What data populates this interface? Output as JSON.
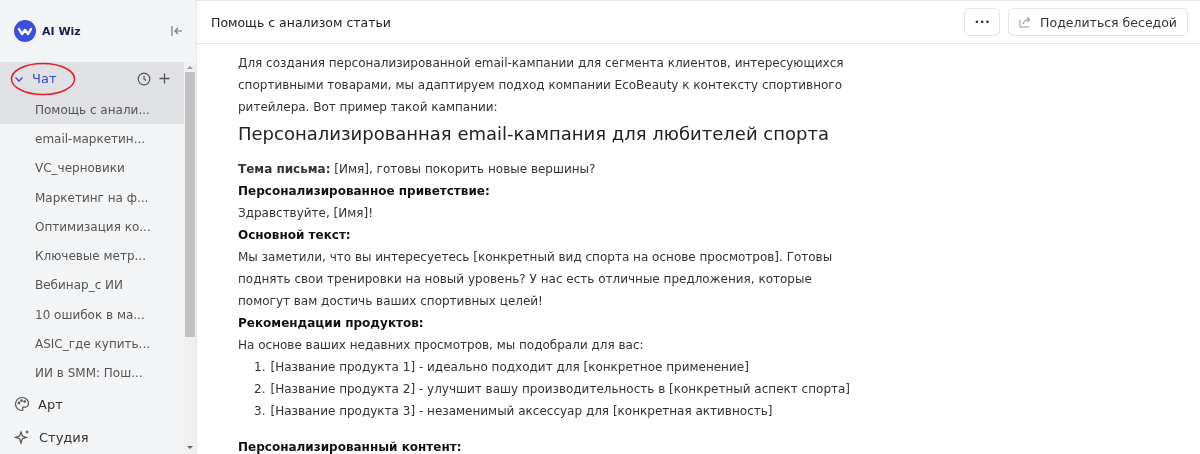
{
  "app": {
    "name": "AI Wiz"
  },
  "sidebar": {
    "sections": [
      {
        "label": "Чат",
        "kind": "chat",
        "expanded": true,
        "selected": true,
        "highlighted": true,
        "items": [
          {
            "label": "Помощь с анали...",
            "selected": true
          },
          {
            "label": "email-маркетин...",
            "selected": false
          },
          {
            "label": "VC_черновики",
            "selected": false
          },
          {
            "label": "Маркетинг на ф...",
            "selected": false
          },
          {
            "label": "Оптимизация ко...",
            "selected": false
          },
          {
            "label": "Ключевые метр...",
            "selected": false
          },
          {
            "label": "Вебинар_с ИИ",
            "selected": false
          },
          {
            "label": "10 ошибок в ма...",
            "selected": false
          },
          {
            "label": "ASIC_где купить...",
            "selected": false
          },
          {
            "label": "ИИ в SMM: Пош...",
            "selected": false
          }
        ]
      },
      {
        "label": "Арт",
        "kind": "art",
        "selected": false
      },
      {
        "label": "Студия",
        "kind": "studio",
        "selected": false
      }
    ]
  },
  "header": {
    "title": "Помощь с анализом статьи",
    "more_button": "•••",
    "share_button": "Поделиться беседой"
  },
  "message": [
    {
      "kind": "paragraph",
      "text": "Для создания персонализированной email-кампании для сегмента клиентов, интересующихся спортивными товарами, мы адаптируем подход компании EcoBeauty к контексту спортивного ритейлера. Вот пример такой кампании:"
    },
    {
      "kind": "heading",
      "text": "Персонализированная email-кампания для любителей спорта"
    },
    {
      "kind": "paragraph",
      "text": "**Тема письма:** [Имя], готовы покорить новые вершины?"
    },
    {
      "kind": "label",
      "text": "Персонализированное приветствие:"
    },
    {
      "kind": "paragraph",
      "text": "Здравствуйте, [Имя]!"
    },
    {
      "kind": "label",
      "text": "Основной текст:"
    },
    {
      "kind": "paragraph",
      "text": "Мы заметили, что вы интересуетесь [конкретный вид спорта на основе просмотров]. Готовы поднять свои тренировки на новый уровень? У нас есть отличные предложения, которые помогут вам достичь ваших спортивных целей!"
    },
    {
      "kind": "label",
      "text": "Рекомендации продуктов:"
    },
    {
      "kind": "paragraph",
      "text": "На основе ваших недавних просмотров, мы подобрали для вас:"
    },
    {
      "kind": "list",
      "items": [
        {
          "number": "1.",
          "text": "[Название продукта 1] - идеально подходит для [конкретное применение]"
        },
        {
          "number": "2.",
          "text": "[Название продукта 2] - улучшит вашу производительность в [конкретный аспект спорта]"
        },
        {
          "number": "3.",
          "text": "[Название продукта 3] - незаменимый аксессуар для [конкретная активность]"
        }
      ]
    },
    {
      "kind": "label",
      "text": "Персонализированный контент:"
    }
  ]
}
